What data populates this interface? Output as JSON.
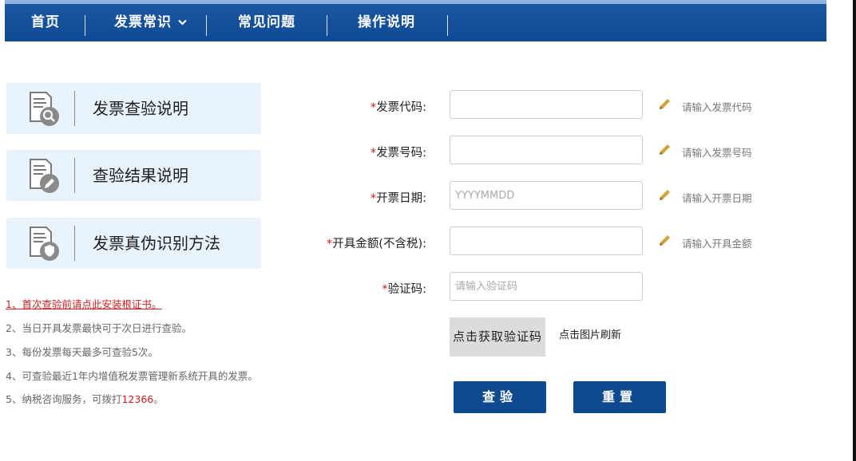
{
  "nav": {
    "items": [
      {
        "label": "首页"
      },
      {
        "label": "发票常识",
        "dropdown": true
      },
      {
        "label": "常见问题"
      },
      {
        "label": "操作说明"
      }
    ],
    "dropdown_icon": "chevron-down-icon"
  },
  "panels": [
    {
      "label": "发票查验说明",
      "icon": "document-search-icon"
    },
    {
      "label": "查验结果说明",
      "icon": "document-edit-icon"
    },
    {
      "label": "发票真伪识别方法",
      "icon": "document-shield-icon"
    }
  ],
  "notes": {
    "n1": "1、首次查验前请点此安装根证书。",
    "n2": "2、当日开具发票最快可于次日进行查验。",
    "n3": "3、每份发票每天最多可查验5次。",
    "n4": "4、可查验最近1年内增值税发票管理新系统开具的发票。",
    "n5_prefix": "5、纳税咨询服务，可拨打",
    "n5_phone": "12366",
    "n5_suffix": "。"
  },
  "form": {
    "required_mark": "*",
    "invoice_code": {
      "label": "发票代码:",
      "value": "",
      "placeholder": "",
      "hint": "请输入发票代码"
    },
    "invoice_number": {
      "label": "发票号码:",
      "value": "",
      "placeholder": "",
      "hint": "请输入发票号码"
    },
    "issue_date": {
      "label": "开票日期:",
      "value": "",
      "placeholder": "YYYYMMDD",
      "hint": "请输入开票日期"
    },
    "amount": {
      "label": "开具金额(不含税):",
      "value": "",
      "placeholder": "",
      "hint": "请输入开具金额"
    },
    "captcha": {
      "label": "验证码:",
      "value": "",
      "placeholder": "请输入验证码"
    },
    "captcha_image_text": "点击获取验证码",
    "captcha_refresh": "点击图片刷新"
  },
  "buttons": {
    "check": "查验",
    "reset": "重置"
  },
  "colors": {
    "nav_bg": "#0f4a94",
    "panel_bg": "#e8f3fb",
    "required": "#d01e1e",
    "button_bg": "#0f4a91",
    "pencil": "#d4a23a"
  }
}
